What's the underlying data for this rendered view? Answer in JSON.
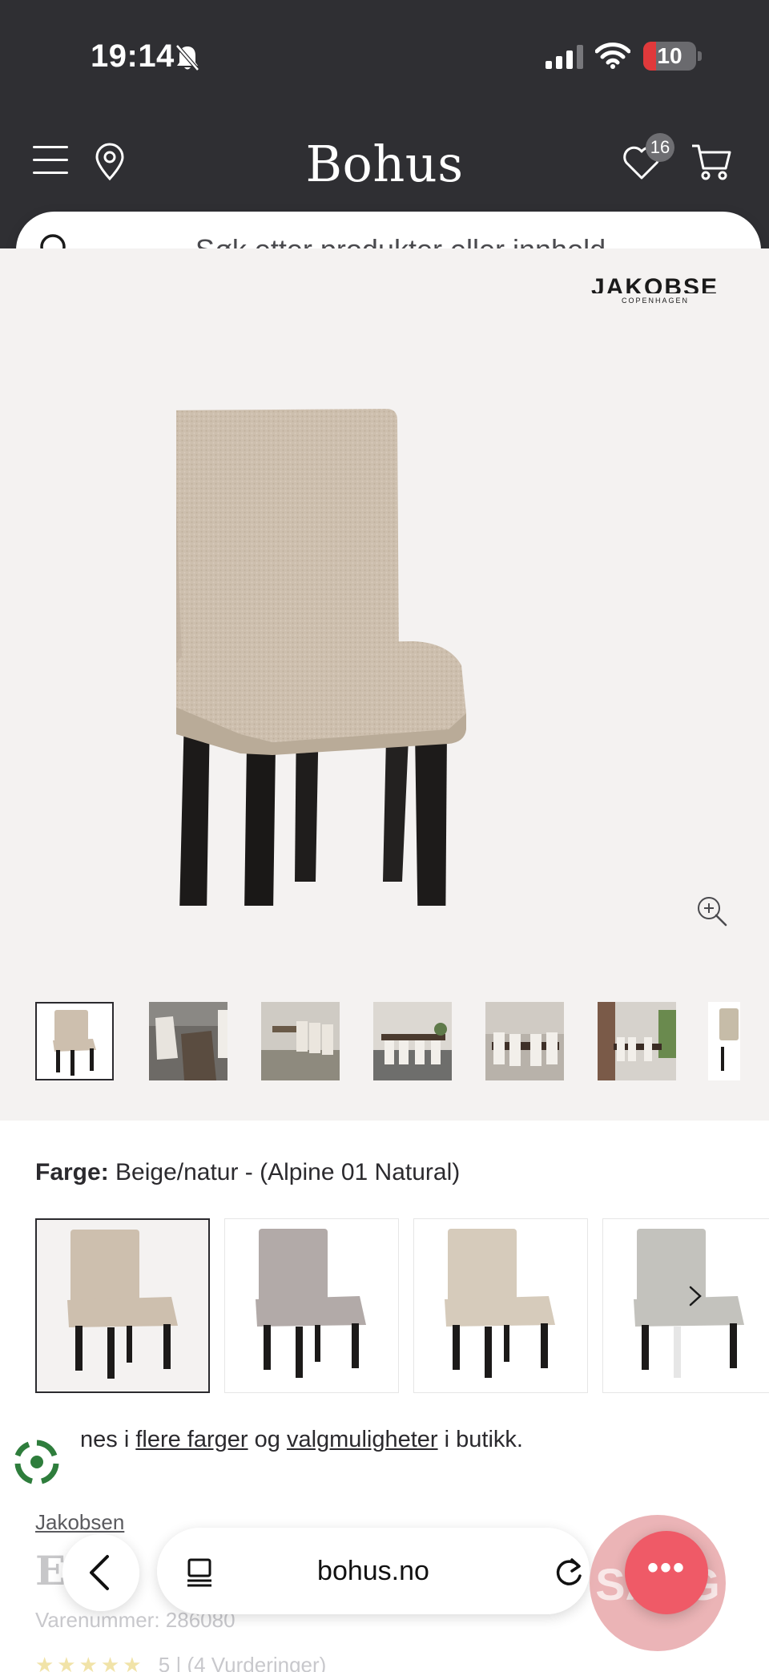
{
  "status_bar": {
    "time": "19:14",
    "battery": "10",
    "battery_level": 0.1
  },
  "header": {
    "logo": "Bohus",
    "favorites_count": "16",
    "search_placeholder": "Søk etter produkter eller innhold ..."
  },
  "gallery": {
    "brand_logo_main": "JAKOBSEN",
    "brand_logo_sub": "COPENHAGEN",
    "thumbnail_count": 7,
    "active_thumbnail": 1
  },
  "product": {
    "color_label": "Farge:",
    "color_value": "Beige/natur - (Alpine 01 Natural)",
    "swatches": [
      {
        "name": "beige",
        "fabric": "#cdbfae"
      },
      {
        "name": "grey-taupe",
        "fabric": "#b2aaa8"
      },
      {
        "name": "natural",
        "fabric": "#d6cbbb"
      },
      {
        "name": "light-grey",
        "fabric": "#c3c2bd"
      }
    ],
    "availability_pre": "nes i",
    "availability_link1": "flere farger",
    "availability_mid": "og",
    "availability_link2": "valgmuligheter",
    "availability_post": "i butikk.",
    "brand": "Jakobsen",
    "title": "E",
    "sku": "Varenummer: 286080",
    "rating_stars": "★★★★★",
    "rating_text": "5 | (4 Vurderinger)"
  },
  "browser": {
    "url": "bohus.no",
    "sale_text": "SALG",
    "more_label": "•••"
  },
  "colors": {
    "header_bg": "#2f2f33",
    "image_bg": "#f4f2f1",
    "accent": "#ef5a67"
  }
}
